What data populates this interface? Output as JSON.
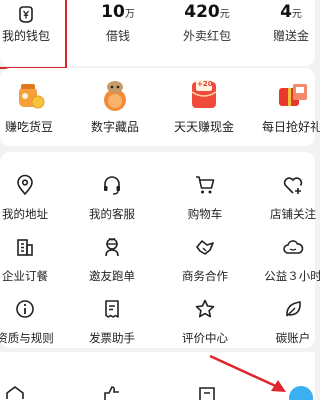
{
  "wallet": {
    "label": "我的钱包",
    "icon": "wallet-icon"
  },
  "stats": [
    {
      "value": "10",
      "unit": "万",
      "label": "借钱"
    },
    {
      "value": "420",
      "unit": "元",
      "label": "外卖红包"
    },
    {
      "value": "4",
      "unit": "元",
      "label": "赠送金"
    }
  ],
  "promos": [
    {
      "label": "赚吃货豆",
      "icon": "coin-jar-icon"
    },
    {
      "label": "数字藏品",
      "icon": "mascot-figure-icon"
    },
    {
      "label": "天天赚现金",
      "icon": "red-envelope-icon",
      "badge": "+20"
    },
    {
      "label": "每日抢好礼",
      "icon": "gift-box-icon"
    }
  ],
  "services": [
    {
      "label": "我的地址",
      "icon": "location-pin-icon"
    },
    {
      "label": "我的客服",
      "icon": "headset-icon"
    },
    {
      "label": "购物车",
      "icon": "shopping-cart-icon"
    },
    {
      "label": "店铺关注",
      "icon": "heart-plus-icon"
    },
    {
      "label": "企业订餐",
      "icon": "building-icon"
    },
    {
      "label": "邀友跑单",
      "icon": "rider-icon"
    },
    {
      "label": "商务合作",
      "icon": "handshake-icon"
    },
    {
      "label": "公益３小时",
      "icon": "cloud-icon"
    },
    {
      "label": "资质与规则",
      "icon": "info-circle-icon"
    },
    {
      "label": "发票助手",
      "icon": "invoice-icon"
    },
    {
      "label": "评价中心",
      "icon": "star-icon"
    },
    {
      "label": "碳账户",
      "icon": "leaf-icon"
    }
  ],
  "bottom_nav": [
    "home-icon",
    "thumbs-up-icon",
    "orders-icon",
    "profile-icon"
  ],
  "colors": {
    "highlight": "#d9272e",
    "accent": "#3ab0f0"
  }
}
